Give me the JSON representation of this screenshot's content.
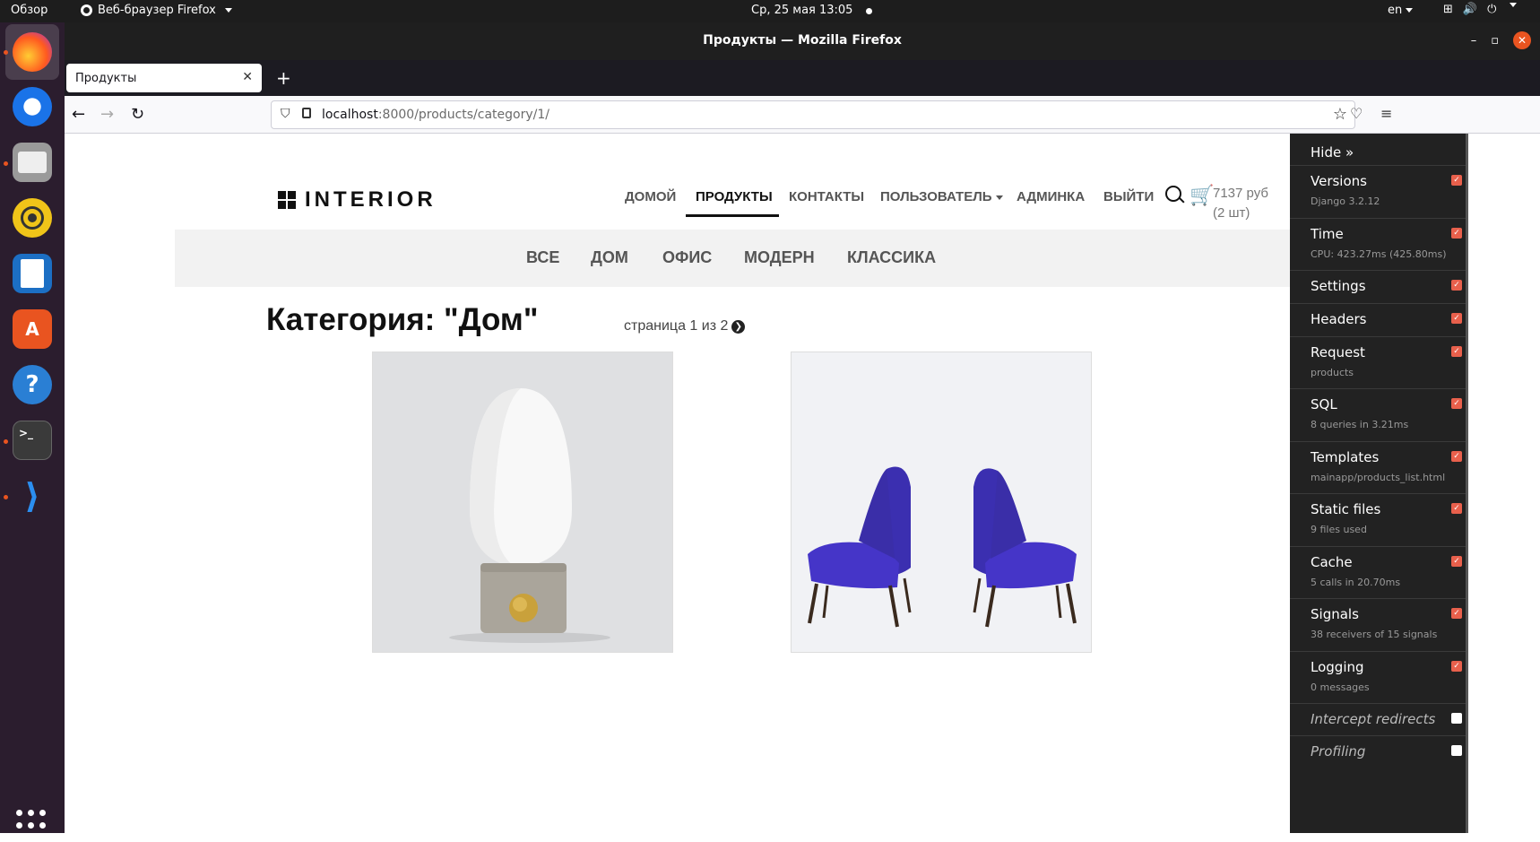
{
  "os": {
    "activities": "Обзор",
    "app_name": "Веб-браузер Firefox",
    "datetime": "Ср, 25 мая  13:05",
    "lang": "en"
  },
  "browser": {
    "window_title": "Продукты — Mozilla Firefox",
    "tab_title": "Продукты",
    "url_host": "localhost",
    "url_path": ":8000/products/category/1/"
  },
  "site": {
    "logo": "INTERIOR",
    "nav": [
      "ДОМОЙ",
      "ПРОДУКТЫ",
      "КОНТАКТЫ",
      "ПОЛЬЗОВАТЕЛЬ",
      "АДМИНКА",
      "ВЫЙТИ"
    ],
    "cart_sum": "7137 руб",
    "cart_count": "(2 шт)",
    "categories": [
      "ВСЕ",
      "ДОМ",
      "ОФИС",
      "МОДЕРН",
      "КЛАССИКА"
    ],
    "heading": "Категория: \"Дом\"",
    "pager": "страница 1 из 2"
  },
  "debug_toolbar": {
    "hide": "Hide »",
    "panels": [
      {
        "label": "Versions",
        "sub": "Django 3.2.12",
        "checked": true
      },
      {
        "label": "Time",
        "sub": "CPU: 423.27ms (425.80ms)",
        "checked": true
      },
      {
        "label": "Settings",
        "sub": "",
        "checked": true
      },
      {
        "label": "Headers",
        "sub": "",
        "checked": true
      },
      {
        "label": "Request",
        "sub": "products",
        "checked": true
      },
      {
        "label": "SQL",
        "sub": "8 queries in 3.21ms",
        "checked": true
      },
      {
        "label": "Templates",
        "sub": "mainapp/products_list.html",
        "checked": true
      },
      {
        "label": "Static files",
        "sub": "9 files used",
        "checked": true
      },
      {
        "label": "Cache",
        "sub": "5 calls in 20.70ms",
        "checked": true
      },
      {
        "label": "Signals",
        "sub": "38 receivers of 15 signals",
        "checked": true
      },
      {
        "label": "Logging",
        "sub": "0 messages",
        "checked": true
      },
      {
        "label": "Intercept redirects",
        "sub": "",
        "checked": false
      },
      {
        "label": "Profiling",
        "sub": "",
        "checked": false
      }
    ]
  }
}
